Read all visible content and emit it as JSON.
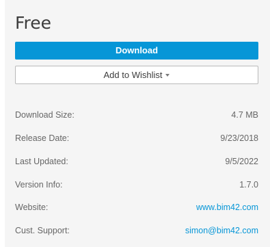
{
  "price": "Free",
  "actions": {
    "download_label": "Download",
    "wishlist_label": "Add to Wishlist"
  },
  "details": [
    {
      "label": "Download Size:",
      "value": "4.7 MB",
      "link": false
    },
    {
      "label": "Release Date:",
      "value": "9/23/2018",
      "link": false
    },
    {
      "label": "Last Updated:",
      "value": "9/5/2022",
      "link": false
    },
    {
      "label": "Version Info:",
      "value": "1.7.0",
      "link": false
    },
    {
      "label": "Website:",
      "value": "www.bim42.com",
      "link": true
    },
    {
      "label": "Cust. Support:",
      "value": "simon@bim42.com",
      "link": true
    }
  ],
  "colors": {
    "accent": "#0696d7",
    "panel_bg": "#f5f5f5",
    "text": "#666666"
  },
  "icons": {
    "wishlist_dropdown": "caret-down-icon"
  }
}
